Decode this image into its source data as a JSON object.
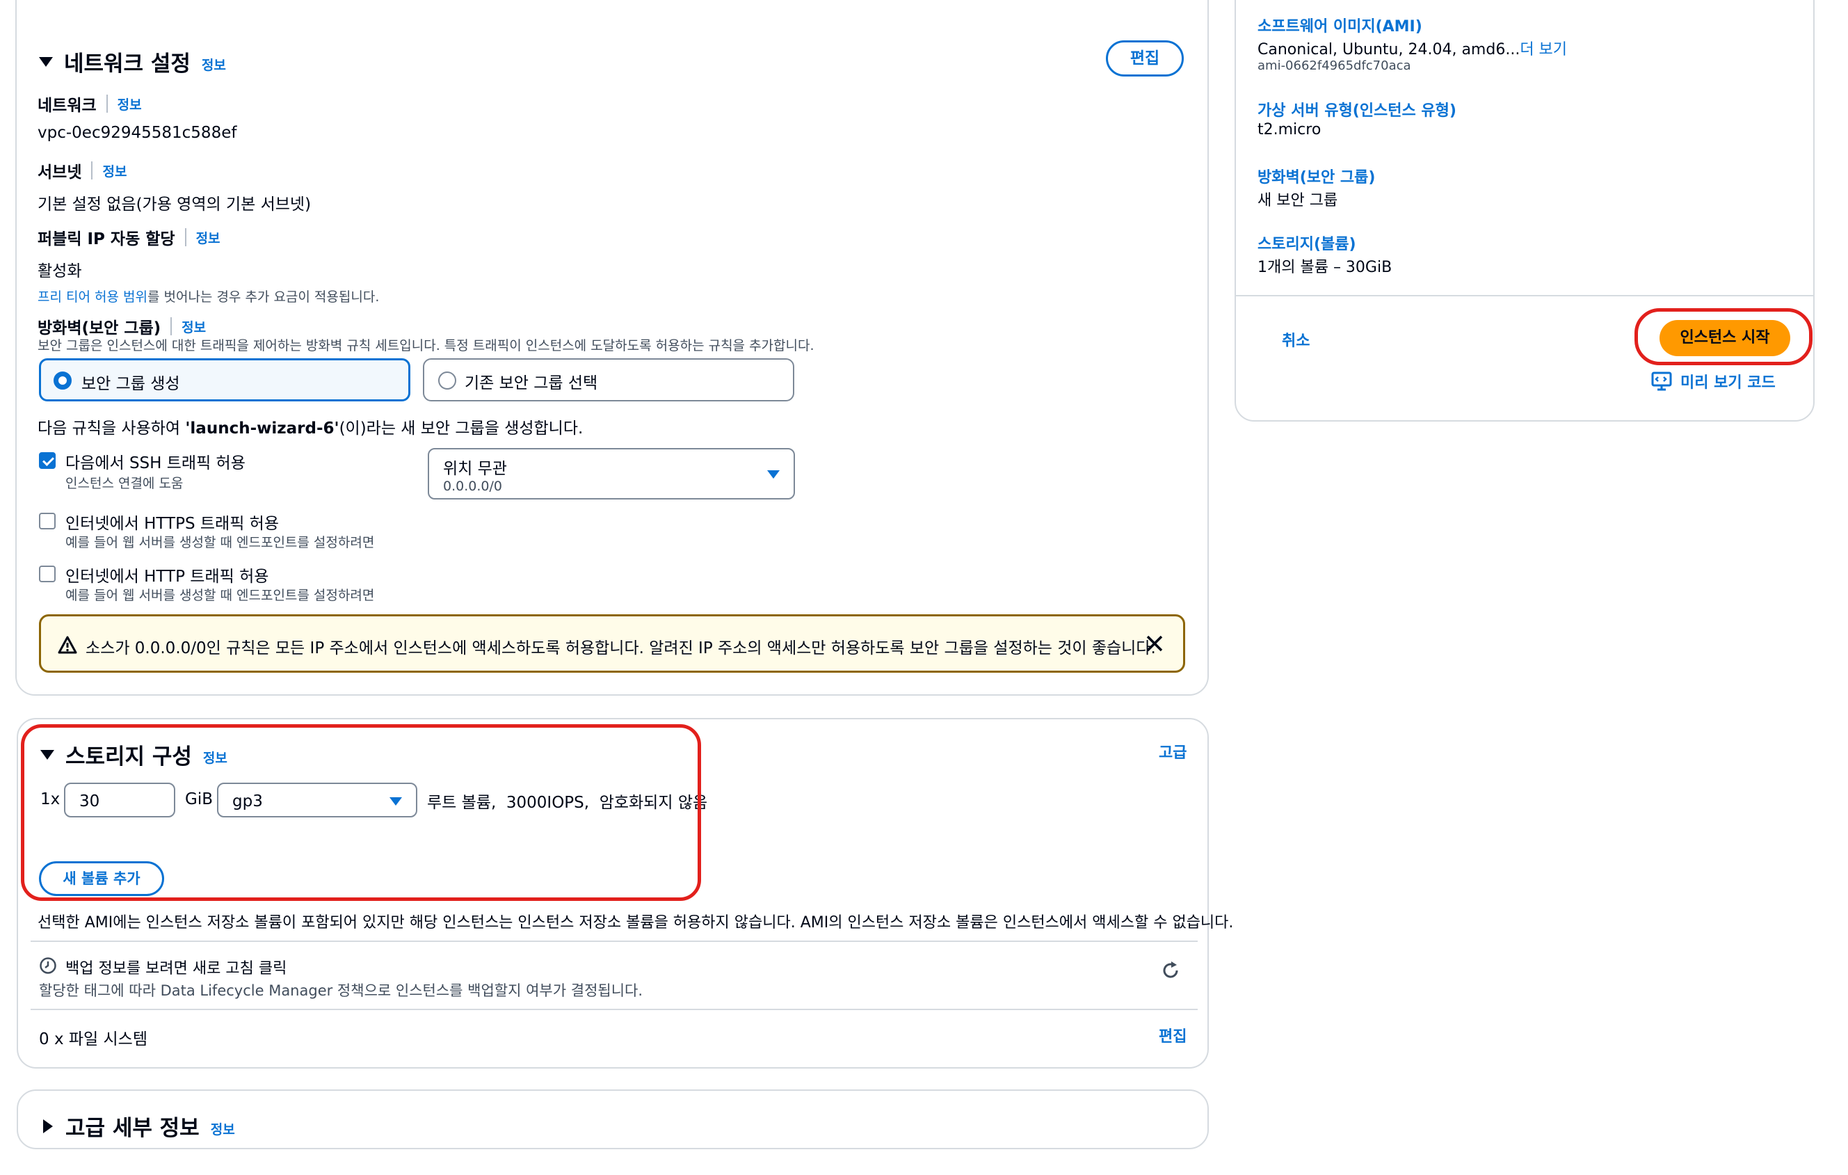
{
  "network": {
    "title": "네트워크 설정",
    "info": "정보",
    "edit": "편집",
    "network_label": "네트워크",
    "network_value": "vpc-0ec92945581c588ef",
    "subnet_label": "서브넷",
    "subnet_value": "기본 설정 없음(가용 영역의 기본 서브넷)",
    "public_ip_label": "퍼블릭 IP 자동 할당",
    "public_ip_value": "활성화",
    "free_tier_link": "프리 티어 허용 범위",
    "free_tier_text": "를 벗어나는 경우 추가 요금이 적용됩니다.",
    "firewall_label": "방화벽(보안 그룹)",
    "firewall_desc": "보안 그룹은 인스턴스에 대한 트래픽을 제어하는 방화벽 규칙 세트입니다. 특정 트래픽이 인스턴스에 도달하도록 허용하는 규칙을 추가합니다.",
    "option_create": "보안 그룹 생성",
    "option_existing": "기존 보안 그룹 선택",
    "rule_text_pre": "다음 규칙을 사용하여 ",
    "rule_text_name": "'launch-wizard-6'",
    "rule_text_post": "(이)라는 새 보안 그룹을 생성합니다.",
    "ssh_label": "다음에서 SSH 트래픽 허용",
    "ssh_desc": "인스턴스 연결에 도움",
    "ssh_source": "위치 무관",
    "ssh_source_cidr": "0.0.0.0/0",
    "https_label": "인터넷에서 HTTPS 트래픽 허용",
    "https_desc": "예를 들어 웹 서버를 생성할 때 엔드포인트를 설정하려면",
    "http_label": "인터넷에서 HTTP 트래픽 허용",
    "http_desc": "예를 들어 웹 서버를 생성할 때 엔드포인트를 설정하려면",
    "warning": "소스가 0.0.0.0/0인 규칙은 모든 IP 주소에서 인스턴스에 액세스하도록 허용합니다. 알려진 IP 주소의 액세스만 허용하도록 보안 그룹을 설정하는 것이 좋습니다."
  },
  "storage": {
    "title": "스토리지 구성",
    "info": "정보",
    "advanced": "고급",
    "count": "1x",
    "size": "30",
    "unit": "GiB",
    "volume_type": "gp3",
    "volume_desc": "루트 볼륨,  3000IOPS,  암호화되지 않음",
    "add_volume": "새 볼륨 추가",
    "ami_note": "선택한 AMI에는 인스턴스 저장소 볼륨이 포함되어 있지만 해당 인스턴스는 인스턴스 저장소 볼륨을 허용하지 않습니다. AMI의 인스턴스 저장소 볼륨은 인스턴스에서 액세스할 수 없습니다.",
    "backup_title": "백업 정보를 보려면 새로 고침 클릭",
    "backup_desc": "할당한 태그에 따라 Data Lifecycle Manager 정책으로 인스턴스를 백업할지 여부가 결정됩니다.",
    "filesystems": "0 x 파일 시스템",
    "edit": "편집"
  },
  "advanced": {
    "title": "고급 세부 정보",
    "info": "정보"
  },
  "summary": {
    "ami_label": "소프트웨어 이미지(AMI)",
    "ami_value": "Canonical, Ubuntu, 24.04, amd6...",
    "ami_more": "더 보기",
    "ami_id": "ami-0662f4965dfc70aca",
    "type_label": "가상 서버 유형(인스턴스 유형)",
    "type_value": "t2.micro",
    "sg_label": "방화벽(보안 그룹)",
    "sg_value": "새 보안 그룹",
    "storage_label": "스토리지(볼륨)",
    "storage_value": "1개의 볼륨 – 30GiB",
    "cancel": "취소",
    "launch": "인스턴스 시작",
    "preview_code": "미리 보기 코드"
  },
  "colors": {
    "accent": "#0972d3",
    "launch": "#ff9900",
    "highlight": "#e2201c",
    "warning_border": "#8d6605",
    "warning_bg": "#fffce9"
  }
}
